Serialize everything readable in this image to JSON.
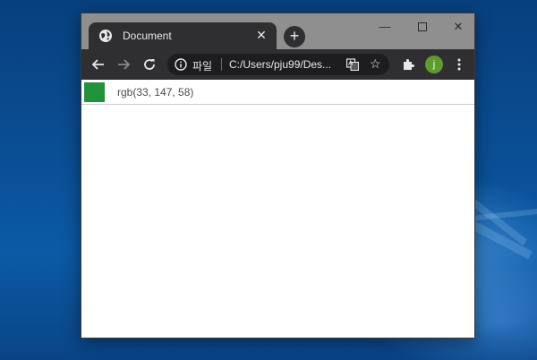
{
  "tab": {
    "title": "Document",
    "icon": "globe-icon"
  },
  "toolbar": {
    "scheme_label": "파일",
    "url": "C:/Users/pju99/Des...",
    "avatar_initial": "j"
  },
  "content": {
    "swatch_color": "#21933a",
    "color_text": "rgb(33, 147, 58)"
  },
  "colors": {
    "titlebar": "#8f8f8f",
    "toolbar": "#2f2f32",
    "avatar": "#5f9b2f"
  }
}
